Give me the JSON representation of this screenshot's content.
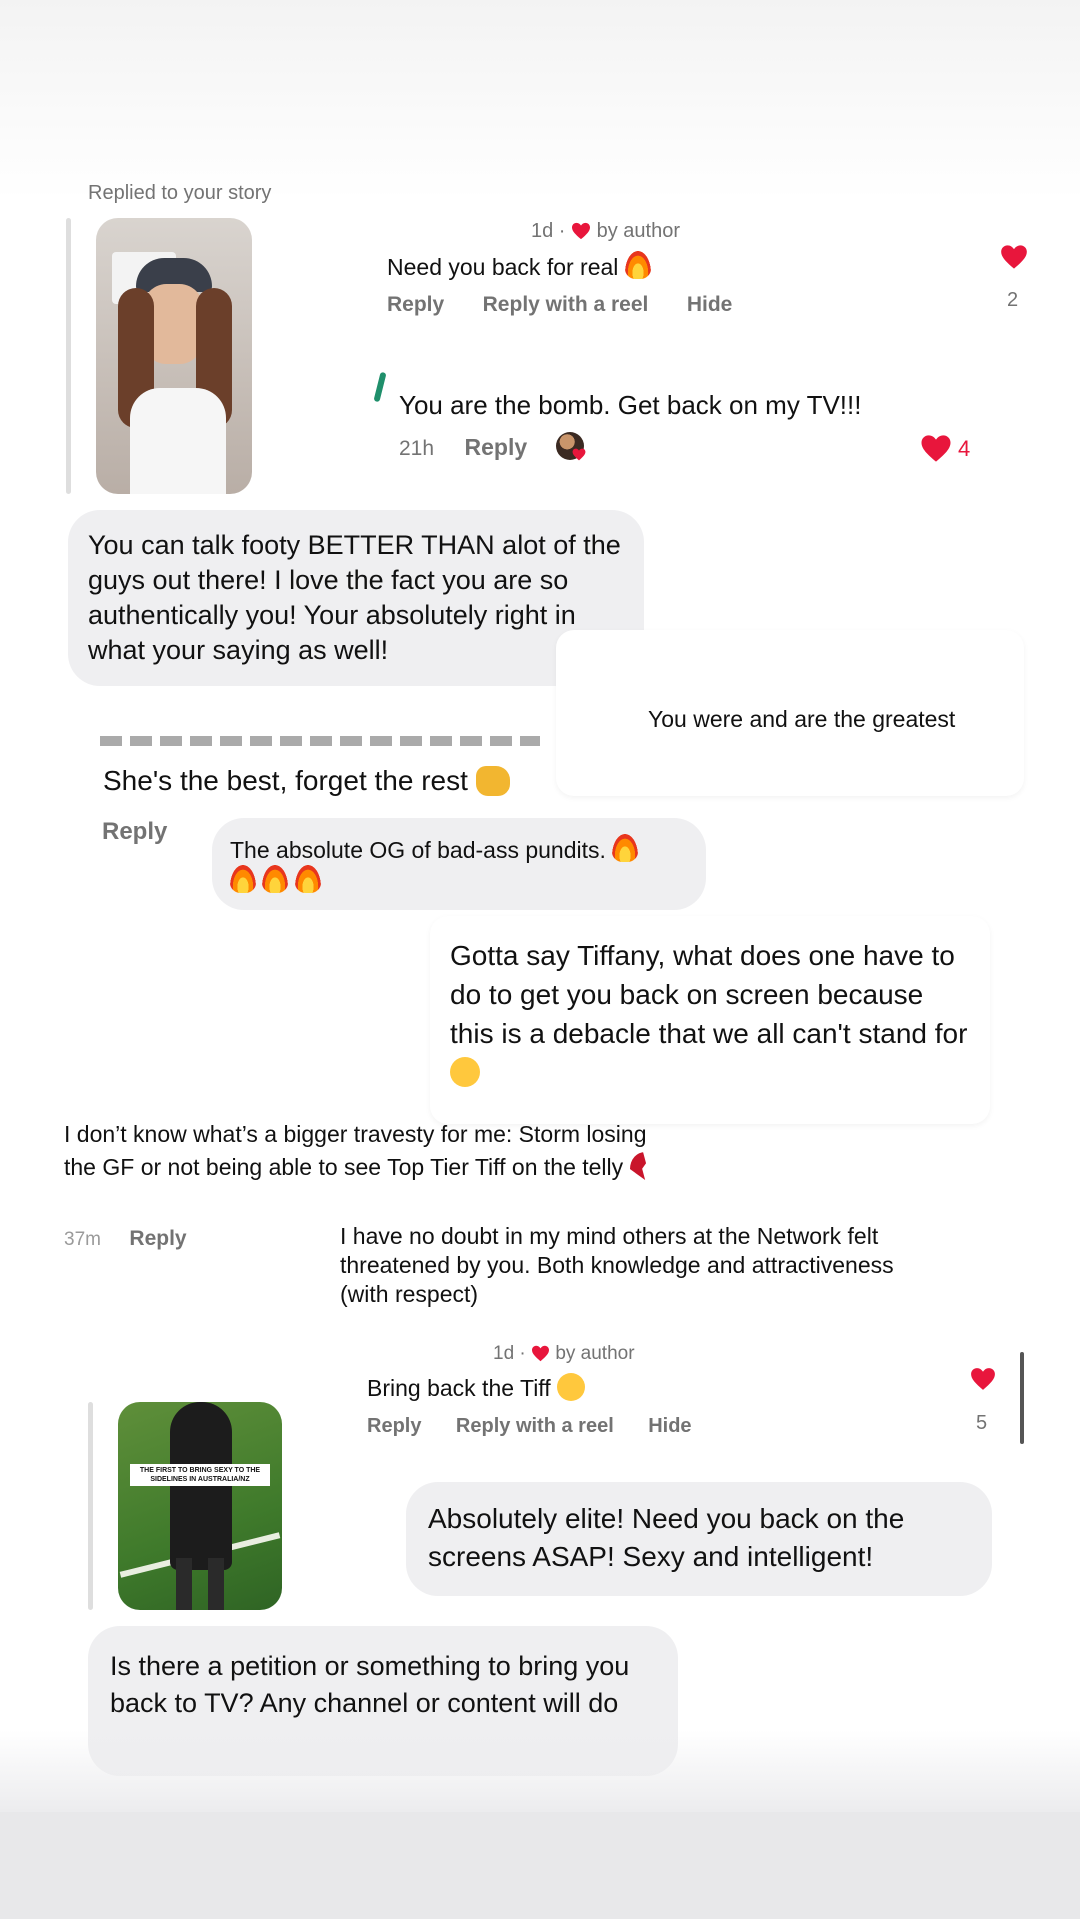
{
  "story_reply_label": "Replied to your story",
  "comment1": {
    "meta_time": "1d ·",
    "meta_by": "by author",
    "text": "Need you back for real",
    "reply": "Reply",
    "reply_reel": "Reply with a reel",
    "hide": "Hide",
    "likes": "2"
  },
  "comment2": {
    "text": "You are the bomb. Get back on my TV!!!",
    "time": "21h",
    "reply": "Reply",
    "likes": "4"
  },
  "bubble1": {
    "text": "You can talk footy BETTER THAN alot of the guys out there! I love the fact you are so authentically you! Your absolutely right in what your saying as well!"
  },
  "card_greatest": {
    "text": "You were and are the greatest"
  },
  "comment3": {
    "text": "She's the best, forget the rest",
    "reply": "Reply"
  },
  "bubble2": {
    "text": "The absolute OG of bad-ass pundits."
  },
  "card_tiffany": {
    "text": "Gotta say Tiffany, what does one have to do to get you back on screen because this is a debacle that we all can't stand for"
  },
  "comment4": {
    "text": "I don’t know what’s a bigger travesty for me: Storm losing the GF or not being able to see Top Tier Tiff on the telly",
    "time": "37m",
    "reply": "Reply"
  },
  "comment5": {
    "text": "I have no doubt in my mind others at the Network felt threatened by you. Both knowledge and attractiveness (with respect)"
  },
  "comment6": {
    "meta_time": "1d ·",
    "meta_by": "by author",
    "text": "Bring back the Tiff",
    "reply": "Reply",
    "reply_reel": "Reply with a reel",
    "hide": "Hide",
    "likes": "5"
  },
  "thumb2": {
    "caption": "THE FIRST TO BRING SEXY TO THE SIDELINES IN AUSTRALIA/NZ"
  },
  "bubble3": {
    "text": "Absolutely elite! Need you back on the screens ASAP! Sexy and intelligent!"
  },
  "bubble4": {
    "text": "Is there a petition or something to bring you back to TV? Any channel or content will do"
  },
  "colors": {
    "heart": "#e8163c",
    "bubble": "#efeff1",
    "muted": "#737373"
  }
}
